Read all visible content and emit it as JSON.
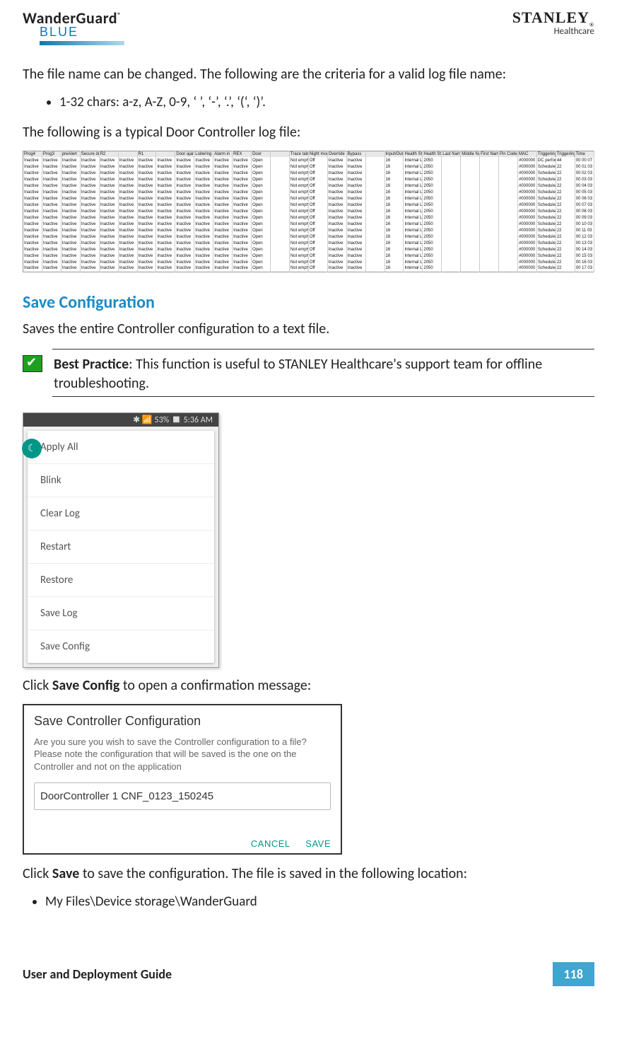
{
  "brand": {
    "wg": "WanderGuard",
    "reg": "®",
    "blue": "BLUE",
    "stanley": "STANLEY",
    "hc": "Healthcare"
  },
  "para1": "The file name can be changed. The following are the criteria for a valid log file name:",
  "bullet1": "1-32 chars: a-z, A-Z, 0-9, ‘ ’, ‘-’, ‘.’, ‘(‘, ‘)’.",
  "para2": "The following is a typical Door Controller log file:",
  "log": {
    "headers": [
      "Prog4",
      "Prog3",
      "preAlert",
      "Secure do",
      "R2",
      "",
      "R1",
      "",
      "Door ajar",
      "Loitering",
      "Alarm in",
      "REX",
      "Door",
      "",
      "Trace tabl",
      "Night mod",
      "Override",
      "Bypass",
      "",
      "Input/Outp",
      "Health Sta",
      "Health Sta",
      "Last Name",
      "Middle Na",
      "First Name",
      "Pin Code",
      "MAC",
      "Triggering",
      "Triggering",
      "Time"
    ],
    "row_common": [
      "Inactive",
      "Inactive",
      "Inactive",
      "Inactive",
      "Inactive",
      "Inactive",
      "Inactive",
      "Inactive",
      "Inactive",
      "Inactive",
      "Inactive",
      "Inactive",
      "Open",
      "",
      "Not empty",
      "Off",
      "Inactive",
      "Inactive",
      "",
      "16",
      "Internal LF",
      "2050",
      "",
      "",
      "",
      "",
      "#000000"
    ],
    "first_row_end": [
      "DC perforr",
      "44",
      "00 00 07"
    ],
    "other_row_end": [
      "Scheduled",
      "22"
    ],
    "times": [
      "00 00 07",
      "00 01 03",
      "00 02 03",
      "00 03 03",
      "00 04 03",
      "00 05 03",
      "00 06 03",
      "00 07 03",
      "00 08 03",
      "00 09 03",
      "00 10 03",
      "00 11 03",
      "00 12 03",
      "00 13 03",
      "00 14 03",
      "00 15 03",
      "00 16 03",
      "00 17 03"
    ]
  },
  "section": "Save Configuration",
  "para3": "Saves the entire Controller configuration to a text file.",
  "bp_label": "Best Practice",
  "bp_text": ": This function is useful to STANLEY Healthcare's support team for offline troubleshooting.",
  "phone_status": "✱ 📶 53% 🔲 5:36 AM",
  "menu": [
    "Apply All",
    "Blink",
    "Clear Log",
    "Restart",
    "Restore",
    "Save Log",
    "Save Config"
  ],
  "para4a": "Click ",
  "para4b": "Save Config",
  "para4c": " to open a confirmation message:",
  "dialog": {
    "title": "Save Controller Configuration",
    "body": "Are you sure you wish to save the Controller configuration to a file? Please note the configuration that will be saved is the one on the Controller and not on the application",
    "input": "DoorController 1 CNF_0123_150245",
    "cancel": "CANCEL",
    "save": "SAVE"
  },
  "para5a": "Click ",
  "para5b": "Save",
  "para5c": " to save the configuration. The file is saved in the following location:",
  "bullet2": "My Files\\Device storage\\WanderGuard",
  "footer": "User and Deployment Guide",
  "page": "118"
}
